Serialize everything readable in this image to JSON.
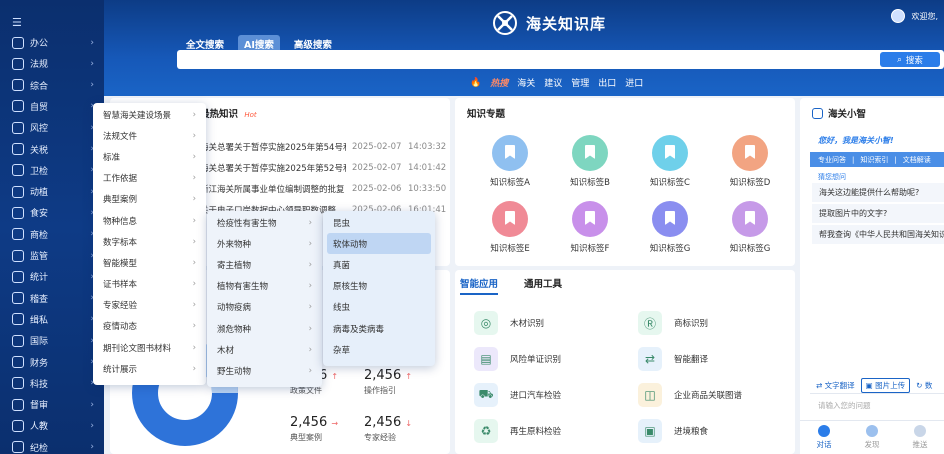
{
  "app": {
    "title": "海关知识库",
    "user_greeting": "欢迎您,"
  },
  "sidebar": {
    "items": [
      {
        "label": "办公",
        "icon": "briefcase-icon"
      },
      {
        "label": "法规",
        "icon": "gavel-icon"
      },
      {
        "label": "综合",
        "icon": "grid-icon"
      },
      {
        "label": "自贸",
        "icon": "compass-icon"
      },
      {
        "label": "风控",
        "icon": "shield-icon"
      },
      {
        "label": "关税",
        "icon": "tax-icon"
      },
      {
        "label": "卫检",
        "icon": "medical-icon"
      },
      {
        "label": "动植",
        "icon": "leaf-icon"
      },
      {
        "label": "食安",
        "icon": "food-icon"
      },
      {
        "label": "商检",
        "icon": "inspect-icon"
      },
      {
        "label": "监管",
        "icon": "eye-icon"
      },
      {
        "label": "统计",
        "icon": "chart-icon"
      },
      {
        "label": "稽查",
        "icon": "audit-icon"
      },
      {
        "label": "缉私",
        "icon": "badge-icon"
      },
      {
        "label": "国际",
        "icon": "globe-icon"
      },
      {
        "label": "财务",
        "icon": "wallet-icon"
      },
      {
        "label": "科技",
        "icon": "chip-icon"
      },
      {
        "label": "督审",
        "icon": "review-icon"
      },
      {
        "label": "人教",
        "icon": "people-icon"
      },
      {
        "label": "纪检",
        "icon": "flag-icon"
      }
    ]
  },
  "search": {
    "tabs": [
      "全文搜索",
      "AI搜索",
      "高级搜索"
    ],
    "active_tab": "AI搜索",
    "button": "搜索"
  },
  "hot": {
    "label": "热搜",
    "terms": [
      "海关",
      "建议",
      "管理",
      "出口",
      "进口"
    ]
  },
  "hot_knowledge": {
    "title": "最热知识",
    "badge": "Hot",
    "items": [
      {
        "title": "海关总署关于暂停实施2025年第54号和第…",
        "date": "2025-02-07",
        "time": "14:03:32"
      },
      {
        "title": "海关总署关于暂停实施2025年第52号和第…",
        "date": "2025-02-07",
        "time": "14:01:42"
      },
      {
        "title": "浙江海关所属事业单位编制调整的批复",
        "date": "2025-02-06",
        "time": "10:33:50"
      },
      {
        "title": "关于电子口岸数据中心领导职数调整…",
        "date": "2025-02-06",
        "time": "16:01:41"
      }
    ]
  },
  "topics": {
    "title": "知识专题",
    "tags": [
      {
        "label": "知识标签A",
        "color": "#8fc0f0"
      },
      {
        "label": "知识标签B",
        "color": "#7ed6c0"
      },
      {
        "label": "知识标签C",
        "color": "#6fd0ea"
      },
      {
        "label": "知识标签D",
        "color": "#f2a482"
      },
      {
        "label": "知识标签E",
        "color": "#f08a96"
      },
      {
        "label": "知识标签F",
        "color": "#c890ea"
      },
      {
        "label": "知识标签G",
        "color": "#8a8ef0"
      },
      {
        "label": "知识标签G",
        "color": "#c69ae8"
      }
    ]
  },
  "tools": {
    "tabs": [
      "智能应用",
      "通用工具"
    ],
    "items": [
      {
        "label": "木材识别",
        "icon": "wood-icon",
        "color": "#e6f7ef"
      },
      {
        "label": "商标识别",
        "icon": "trademark-icon",
        "color": "#e6f7ef"
      },
      {
        "label": "风险单证识别",
        "icon": "document-icon",
        "color": "#ece8fb"
      },
      {
        "label": "智能翻译",
        "icon": "translate-icon",
        "color": "#e6f1fb"
      },
      {
        "label": "进口汽车检验",
        "icon": "car-icon",
        "color": "#e6f1fb"
      },
      {
        "label": "企业商品关联图谱",
        "icon": "graph-icon",
        "color": "#fbf1dc"
      },
      {
        "label": "再生原料检验",
        "icon": "recycle-icon",
        "color": "#e6f7ef"
      },
      {
        "label": "进境粮食",
        "icon": "grain-icon",
        "color": "#e6f1fb"
      }
    ]
  },
  "stats": [
    {
      "value": "2,456",
      "label": "政策文件"
    },
    {
      "value": "2,456",
      "label": "操作指引"
    },
    {
      "value": "2,456",
      "label": "典型案例"
    },
    {
      "value": "2,456",
      "label": "专家经验"
    }
  ],
  "menu1": {
    "items": [
      "智慧海关建设场景",
      "法规文件",
      "标准",
      "工作依据",
      "典型案例",
      "物种信息",
      "数字标本",
      "智能模型",
      "证书样本",
      "专家经验",
      "疫情动态",
      "期刊论文图书材料",
      "统计展示"
    ]
  },
  "menu2": {
    "items": [
      "检疫性有害生物",
      "外来物种",
      "寄主植物",
      "植物有害生物",
      "动物疫病",
      "濒危物种",
      "木材",
      "野生动物"
    ]
  },
  "menu3": {
    "items": [
      "昆虫",
      "软体动物",
      "真菌",
      "原核生物",
      "线虫",
      "病毒及类病毒",
      "杂草"
    ],
    "selected": "软体动物"
  },
  "assistant": {
    "title": "海关小智",
    "greeting": "您好，我是海关小智!",
    "chips": [
      "专业问答",
      "知识索引",
      "文档解读"
    ],
    "guess_label": "猜您想问",
    "questions": [
      "海关这边能提供什么帮助呢?",
      "提取图片中的文字?",
      "帮我查询《中华人民共和国海关知识产"
    ],
    "actions": [
      "文字翻译",
      "图片上传",
      "数"
    ],
    "input_placeholder": "请输入您的问题",
    "nav": [
      "对话",
      "发现",
      "推送"
    ]
  },
  "colors": {
    "primary": "#2b7de9",
    "header": "#1658b8",
    "sidebar": "#0d3577"
  }
}
